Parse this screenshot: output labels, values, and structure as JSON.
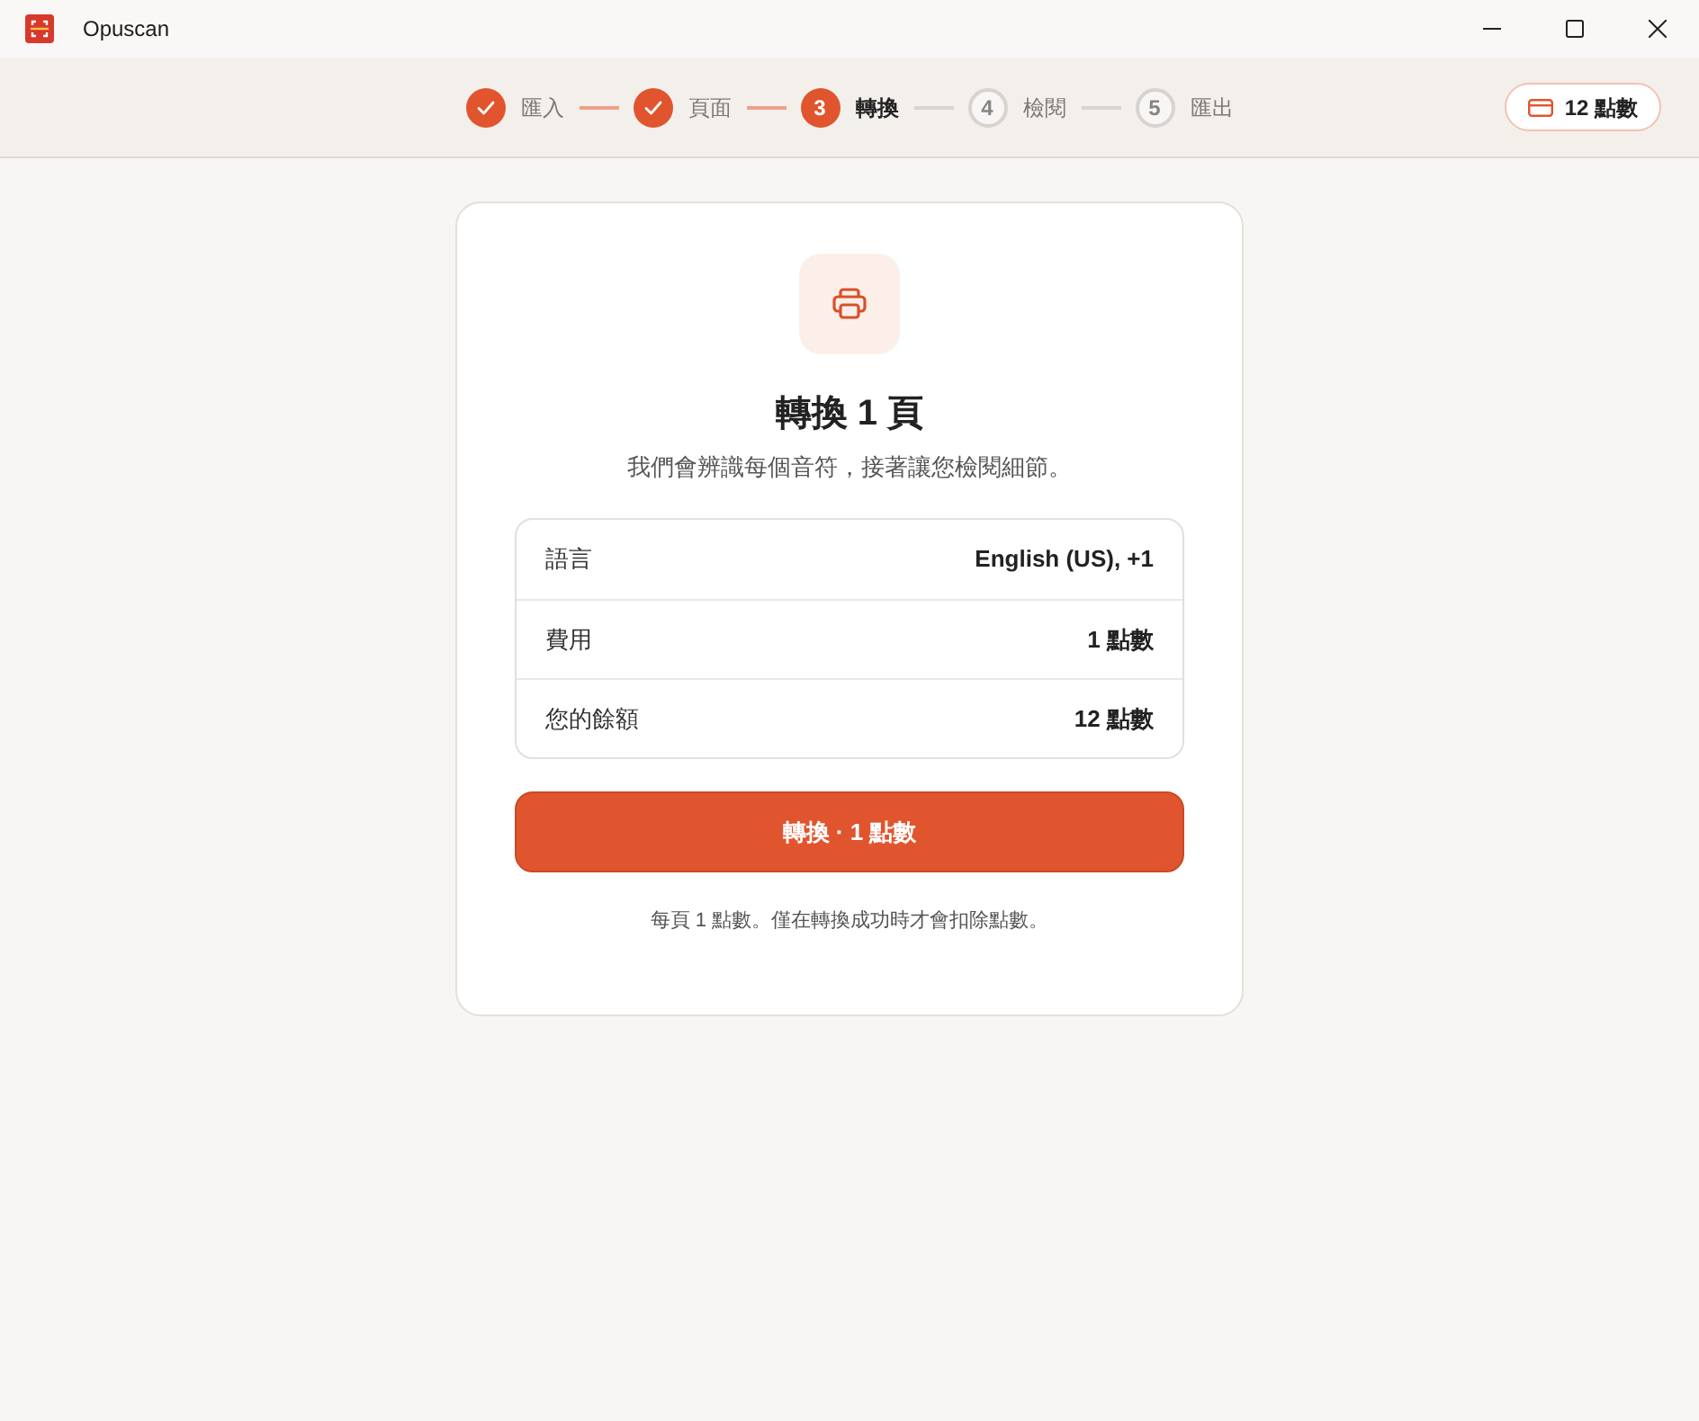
{
  "window": {
    "title": "Opuscan"
  },
  "steps": [
    {
      "label": "匯入",
      "done": true,
      "selected": false
    },
    {
      "label": "頁面",
      "done": true,
      "selected": false
    },
    {
      "number": "3",
      "label": "轉換",
      "done": false,
      "selected": true
    },
    {
      "number": "4",
      "label": "檢閱",
      "done": false,
      "selected": false
    },
    {
      "number": "5",
      "label": "匯出",
      "done": false,
      "selected": false
    }
  ],
  "credits_badge": {
    "text": "12 點數"
  },
  "card": {
    "title": "轉換 1 頁",
    "subtitle": "我們會辨識每個音符，接著讓您檢閱細節。",
    "details": [
      {
        "label": "語言",
        "value": "English (US), +1"
      },
      {
        "label": "費用",
        "value": "1 點數"
      },
      {
        "label": "您的餘額",
        "value": "12 點數"
      }
    ],
    "button": "轉換 · 1 點數",
    "note": "每頁 1 點數。僅在轉換成功時才會扣除點數。"
  }
}
